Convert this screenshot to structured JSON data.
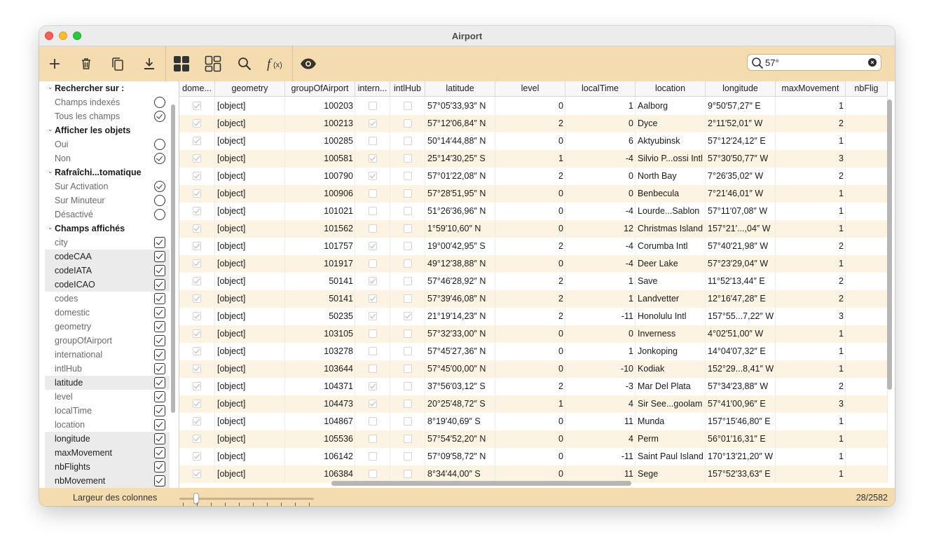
{
  "window": {
    "title": "Airport"
  },
  "toolbar": {
    "buttons": [
      {
        "name": "add",
        "icon": "plus-icon"
      },
      {
        "name": "delete",
        "icon": "trash-icon"
      },
      {
        "name": "duplicate",
        "icon": "copy-icon"
      },
      {
        "name": "download",
        "icon": "download-icon"
      },
      {
        "name": "grid-view",
        "icon": "grid-view-icon"
      },
      {
        "name": "form-view",
        "icon": "form-view-icon"
      },
      {
        "name": "search",
        "icon": "magnifier-icon"
      },
      {
        "name": "formula",
        "icon": "function-icon"
      },
      {
        "name": "visibility",
        "icon": "eye-icon"
      }
    ],
    "search_value": "57°"
  },
  "sidebar": {
    "sections": [
      {
        "title": "Rechercher sur :",
        "control": "radio",
        "items": [
          {
            "label": "Champs indexés",
            "checked": false,
            "hl": false
          },
          {
            "label": "Tous les champs",
            "checked": true,
            "hl": false
          }
        ]
      },
      {
        "title": "Afficher les objets",
        "control": "radio",
        "items": [
          {
            "label": "Oui",
            "checked": false,
            "hl": false
          },
          {
            "label": "Non",
            "checked": true,
            "hl": false
          }
        ]
      },
      {
        "title": "Rafraîchi...tomatique",
        "control": "radio",
        "items": [
          {
            "label": "Sur Activation",
            "checked": true,
            "hl": false
          },
          {
            "label": "Sur Minuteur",
            "checked": false,
            "hl": false
          },
          {
            "label": "Désactivé",
            "checked": false,
            "hl": false
          }
        ]
      },
      {
        "title": "Champs affichés",
        "control": "checkbox",
        "items": [
          {
            "label": "city",
            "checked": true,
            "hl": false
          },
          {
            "label": "codeCAA",
            "checked": true,
            "hl": true
          },
          {
            "label": "codeIATA",
            "checked": true,
            "hl": true
          },
          {
            "label": "codeICAO",
            "checked": true,
            "hl": true
          },
          {
            "label": "codes",
            "checked": true,
            "hl": false
          },
          {
            "label": "domestic",
            "checked": true,
            "hl": false
          },
          {
            "label": "geometry",
            "checked": true,
            "hl": false
          },
          {
            "label": "groupOfAirport",
            "checked": true,
            "hl": false
          },
          {
            "label": "international",
            "checked": true,
            "hl": false
          },
          {
            "label": "intlHub",
            "checked": true,
            "hl": false
          },
          {
            "label": "latitude",
            "checked": true,
            "hl": true
          },
          {
            "label": "level",
            "checked": true,
            "hl": false
          },
          {
            "label": "localTime",
            "checked": true,
            "hl": false
          },
          {
            "label": "location",
            "checked": true,
            "hl": false
          },
          {
            "label": "longitude",
            "checked": true,
            "hl": true
          },
          {
            "label": "maxMovement",
            "checked": true,
            "hl": true
          },
          {
            "label": "nbFlights",
            "checked": true,
            "hl": true
          },
          {
            "label": "nbMovement",
            "checked": true,
            "hl": true
          }
        ]
      }
    ]
  },
  "grid": {
    "columns": [
      {
        "key": "domestic",
        "label": "dome...",
        "type": "check"
      },
      {
        "key": "geometry",
        "label": "geometry",
        "type": "text"
      },
      {
        "key": "groupOfAirport",
        "label": "groupOfAirport",
        "type": "num"
      },
      {
        "key": "international",
        "label": "intern...",
        "type": "check"
      },
      {
        "key": "intlHub",
        "label": "intlHub",
        "type": "check"
      },
      {
        "key": "latitude",
        "label": "latitude",
        "type": "text"
      },
      {
        "key": "level",
        "label": "level",
        "type": "num"
      },
      {
        "key": "localTime",
        "label": "localTime",
        "type": "num"
      },
      {
        "key": "location",
        "label": "location",
        "type": "text"
      },
      {
        "key": "longitude",
        "label": "longitude",
        "type": "text"
      },
      {
        "key": "maxMovement",
        "label": "maxMovement",
        "type": "num"
      },
      {
        "key": "nbFlights",
        "label": "nbFlig",
        "type": "num"
      }
    ],
    "rows": [
      [
        true,
        "[object]",
        "100203",
        false,
        false,
        "57°05′33,93″ N",
        "0",
        "1",
        "Aalborg",
        "9°50′57,27″ E",
        "1",
        ""
      ],
      [
        true,
        "[object]",
        "100213",
        true,
        false,
        "57°12′06,84″ N",
        "2",
        "0",
        "Dyce",
        "2°11′52,01″ W",
        "2",
        ""
      ],
      [
        true,
        "[object]",
        "100285",
        false,
        false,
        "50°14′44,88″ N",
        "0",
        "6",
        "Aktyubinsk",
        "57°12′24,12″ E",
        "1",
        ""
      ],
      [
        true,
        "[object]",
        "100581",
        true,
        false,
        "25°14′30,25″ S",
        "1",
        "-4",
        "Silvio P...ossi Intl",
        "57°30′50,77″ W",
        "3",
        ""
      ],
      [
        true,
        "[object]",
        "100790",
        true,
        false,
        "57°01′22,08″ N",
        "2",
        "0",
        "North Bay",
        "7°26′35,02″ W",
        "2",
        ""
      ],
      [
        true,
        "[object]",
        "100906",
        false,
        false,
        "57°28′51,95″ N",
        "0",
        "0",
        "Benbecula",
        "7°21′46,01″ W",
        "1",
        ""
      ],
      [
        true,
        "[object]",
        "101021",
        false,
        false,
        "51°26′36,96″ N",
        "0",
        "-4",
        "Lourde...Sablon",
        "57°11′07,08″ W",
        "1",
        ""
      ],
      [
        true,
        "[object]",
        "101562",
        false,
        false,
        "1°59′10,60″ N",
        "0",
        "12",
        "Christmas Island",
        "157°21′...,04″ W",
        "1",
        ""
      ],
      [
        true,
        "[object]",
        "101757",
        true,
        false,
        "19°00′42,95″ S",
        "2",
        "-4",
        "Corumba Intl",
        "57°40′21,98″ W",
        "2",
        ""
      ],
      [
        true,
        "[object]",
        "101917",
        false,
        false,
        "49°12′38,88″ N",
        "0",
        "-4",
        "Deer Lake",
        "57°23′29,04″ W",
        "1",
        ""
      ],
      [
        true,
        "[object]",
        "50141",
        true,
        false,
        "57°46′28,92″ N",
        "2",
        "1",
        "Save",
        "11°52′13,44″ E",
        "2",
        ""
      ],
      [
        true,
        "[object]",
        "50141",
        true,
        false,
        "57°39′46,08″ N",
        "2",
        "1",
        "Landvetter",
        "12°16′47,28″ E",
        "2",
        ""
      ],
      [
        true,
        "[object]",
        "50235",
        true,
        true,
        "21°19′14,23″ N",
        "2",
        "-11",
        "Honolulu Intl",
        "157°55...7,22″ W",
        "3",
        ""
      ],
      [
        true,
        "[object]",
        "103105",
        false,
        false,
        "57°32′33,00″ N",
        "0",
        "0",
        "Inverness",
        "4°02′51,00″ W",
        "1",
        ""
      ],
      [
        true,
        "[object]",
        "103278",
        false,
        false,
        "57°45′27,36″ N",
        "0",
        "1",
        "Jonkoping",
        "14°04′07,32″ E",
        "1",
        ""
      ],
      [
        true,
        "[object]",
        "103644",
        false,
        false,
        "57°45′00,00″ N",
        "0",
        "-10",
        "Kodiak",
        "152°29...8,41″ W",
        "1",
        ""
      ],
      [
        true,
        "[object]",
        "104371",
        true,
        false,
        "37°56′03,12″ S",
        "2",
        "-3",
        "Mar Del Plata",
        "57°34′23,88″ W",
        "2",
        ""
      ],
      [
        true,
        "[object]",
        "104473",
        true,
        false,
        "20°25′48,72″ S",
        "1",
        "4",
        "Sir See...goolam",
        "57°41′00,96″ E",
        "3",
        ""
      ],
      [
        true,
        "[object]",
        "104867",
        false,
        false,
        "8°19′40,69″ S",
        "0",
        "11",
        "Munda",
        "157°15′46,80″ E",
        "1",
        ""
      ],
      [
        true,
        "[object]",
        "105536",
        false,
        false,
        "57°54′52,20″ N",
        "0",
        "4",
        "Perm",
        "56°01′16,31″ E",
        "1",
        ""
      ],
      [
        true,
        "[object]",
        "106142",
        false,
        false,
        "57°09′58,72″ N",
        "0",
        "-11",
        "Saint Paul Island",
        "170°13′21,20″ W",
        "1",
        ""
      ],
      [
        true,
        "[object]",
        "106384",
        false,
        false,
        "8°34′44,00″ S",
        "0",
        "11",
        "Sege",
        "157°52′33,63″ E",
        "1",
        ""
      ]
    ]
  },
  "status": {
    "column_width_label": "Largeur des colonnes",
    "record_count": "28/2582"
  }
}
